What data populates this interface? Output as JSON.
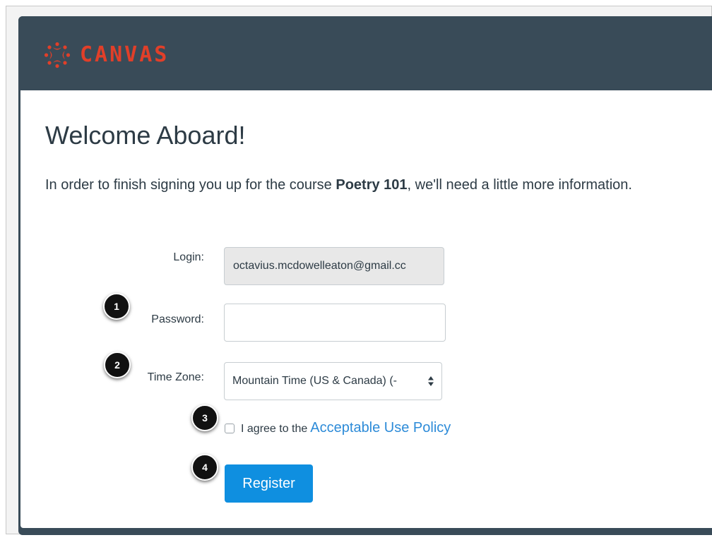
{
  "header": {
    "logo_text": "CANVAS",
    "logo_icon": "canvas-logo-icon",
    "brand_color": "#e13f29",
    "bar_color": "#394b58"
  },
  "page": {
    "title": "Welcome Aboard!",
    "intro_before": "In order to finish signing you up for the course ",
    "course_name": "Poetry 101",
    "intro_after": ", we'll need a little more information."
  },
  "form": {
    "login_label": "Login:",
    "login_value": "octavius.mcdowelleaton@gmail.cc",
    "password_label": "Password:",
    "password_value": "",
    "timezone_label": "Time Zone:",
    "timezone_value": "Mountain Time (US & Canada) (-",
    "agree_text": "I agree to the",
    "policy_link": "Acceptable Use Policy",
    "register_label": "Register",
    "link_color": "#2d8bd8",
    "button_color": "#0f8fe0"
  },
  "callouts": [
    "1",
    "2",
    "3",
    "4"
  ]
}
